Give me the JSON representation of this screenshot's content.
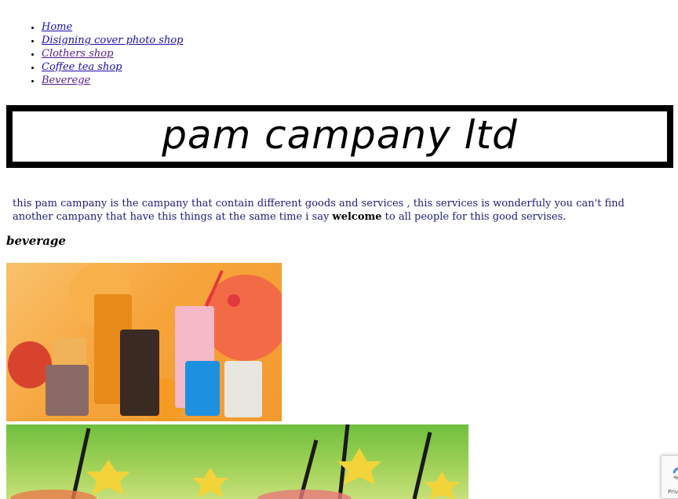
{
  "nav": {
    "items": [
      {
        "label": "Home",
        "visited": false
      },
      {
        "label": "Disigning cover photo shop",
        "visited": false
      },
      {
        "label": "Clothers shop",
        "visited": true
      },
      {
        "label": "Coffee tea shop",
        "visited": false
      },
      {
        "label": "Beverege",
        "visited": true
      }
    ]
  },
  "banner": {
    "title": "pam campany ltd"
  },
  "intro": {
    "before": "this pam campany is the campany that contain different goods and services , this services is wonderfuly you can't find another campany that have this things at the same time i say ",
    "bold": "welcome",
    "after": " to all people for this good servises."
  },
  "section": {
    "heading": "beverage"
  },
  "recaptcha": {
    "text": "Priva"
  },
  "colors": {
    "link": "#1a0dab",
    "visited": "#551a8b",
    "intro_text": "#1c1c7a",
    "banner_border": "#000000"
  }
}
